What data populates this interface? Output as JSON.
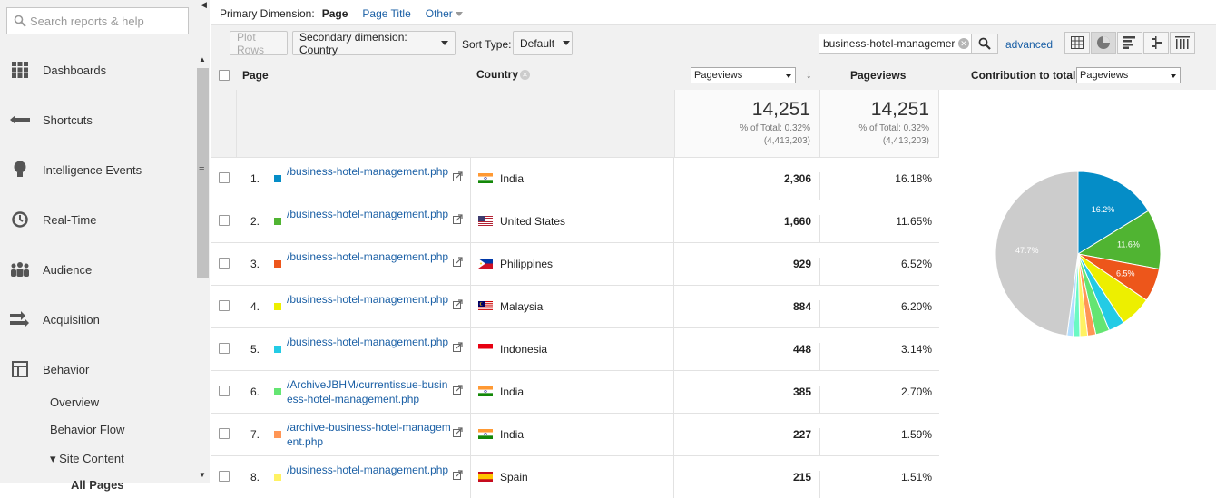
{
  "sidebar": {
    "search_placeholder": "Search reports & help",
    "items": [
      {
        "label": "Dashboards",
        "icon": "dashboards-icon"
      },
      {
        "label": "Shortcuts",
        "icon": "shortcuts-icon"
      },
      {
        "label": "Intelligence Events",
        "icon": "lightbulb-icon"
      },
      {
        "label": "Real-Time",
        "icon": "clock-icon"
      },
      {
        "label": "Audience",
        "icon": "people-icon"
      },
      {
        "label": "Acquisition",
        "icon": "acquisition-icon"
      },
      {
        "label": "Behavior",
        "icon": "behavior-icon"
      }
    ],
    "sub_items": [
      "Overview",
      "Behavior Flow",
      "▾ Site Content",
      "All Pages"
    ]
  },
  "dimension_bar": {
    "label": "Primary Dimension:",
    "active": "Page",
    "page_title": "Page Title",
    "other": "Other"
  },
  "toolbar": {
    "plot_rows": "Plot Rows",
    "secondary_dimension": "Secondary dimension: Country",
    "sort_type_label": "Sort Type:",
    "sort_type_value": "Default",
    "filter_value": "business-hotel-managemer",
    "advanced": "advanced"
  },
  "table": {
    "headers": {
      "page": "Page",
      "country": "Country",
      "metric_select": "Pageviews",
      "pageviews": "Pageviews",
      "contribution_label": "Contribution to total:",
      "contribution_select": "Pageviews"
    },
    "totals": [
      {
        "value": "14,251",
        "pct": "% of Total: 0.32%",
        "of": "(4,413,203)"
      },
      {
        "value": "14,251",
        "pct": "% of Total: 0.32%",
        "of": "(4,413,203)"
      }
    ],
    "rows": [
      {
        "num": "1.",
        "page": "/business-hotel-management.php",
        "country": "India",
        "flag": "india",
        "pageviews": "2,306",
        "pct": "16.18%",
        "color": "#058dc7"
      },
      {
        "num": "2.",
        "page": "/business-hotel-management.php",
        "country": "United States",
        "flag": "us",
        "pageviews": "1,660",
        "pct": "11.65%",
        "color": "#50b432"
      },
      {
        "num": "3.",
        "page": "/business-hotel-management.php",
        "country": "Philippines",
        "flag": "philippines",
        "pageviews": "929",
        "pct": "6.52%",
        "color": "#ed561b"
      },
      {
        "num": "4.",
        "page": "/business-hotel-management.php",
        "country": "Malaysia",
        "flag": "malaysia",
        "pageviews": "884",
        "pct": "6.20%",
        "color": "#edef00"
      },
      {
        "num": "5.",
        "page": "/business-hotel-management.php",
        "country": "Indonesia",
        "flag": "indonesia",
        "pageviews": "448",
        "pct": "3.14%",
        "color": "#24cbe5"
      },
      {
        "num": "6.",
        "page": "/ArchiveJBHM/currentissue-business-hotel-management.php",
        "country": "India",
        "flag": "india",
        "pageviews": "385",
        "pct": "2.70%",
        "color": "#64e572"
      },
      {
        "num": "7.",
        "page": "/archive-business-hotel-management.php",
        "country": "India",
        "flag": "india",
        "pageviews": "227",
        "pct": "1.59%",
        "color": "#ff9655"
      },
      {
        "num": "8.",
        "page": "/business-hotel-management.php",
        "country": "Spain",
        "flag": "spain",
        "pageviews": "215",
        "pct": "1.51%",
        "color": "#fff263"
      }
    ]
  },
  "chart_data": {
    "type": "pie",
    "values": [
      16.18,
      11.65,
      6.52,
      6.2,
      3.14,
      2.7,
      1.59,
      1.51,
      1.3,
      1.2,
      47.7
    ],
    "colors": [
      "#058dc7",
      "#50b432",
      "#ed561b",
      "#edef00",
      "#24cbe5",
      "#64e572",
      "#ff9655",
      "#fff263",
      "#6af9c4",
      "#b2deff",
      "#cccccc"
    ],
    "labels": [
      "16.2%",
      "11.6%",
      "6.5%",
      "",
      "",
      "",
      "",
      "",
      "",
      "",
      "47.7%"
    ]
  }
}
